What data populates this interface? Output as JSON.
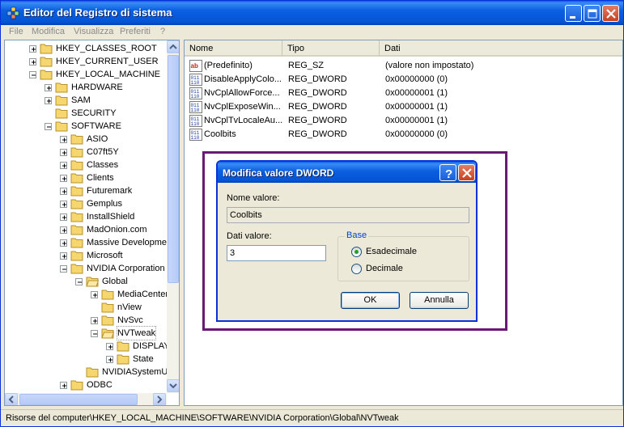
{
  "window": {
    "title": "Editor del Registro di sistema",
    "app_icon": "regedit-icon",
    "controls": [
      "minimize-icon",
      "maximize-icon",
      "close-icon"
    ]
  },
  "menu": [
    "File",
    "Modifica",
    "Visualizza",
    "Preferiti",
    "?"
  ],
  "tree": [
    {
      "label": "HKEY_CLASSES_ROOT",
      "level": 0,
      "state": "collapsed"
    },
    {
      "label": "HKEY_CURRENT_USER",
      "level": 0,
      "state": "collapsed"
    },
    {
      "label": "HKEY_LOCAL_MACHINE",
      "level": 0,
      "state": "expanded"
    },
    {
      "label": "HARDWARE",
      "level": 1,
      "state": "collapsed"
    },
    {
      "label": "SAM",
      "level": 1,
      "state": "collapsed"
    },
    {
      "label": "SECURITY",
      "level": 1,
      "state": "none"
    },
    {
      "label": "SOFTWARE",
      "level": 1,
      "state": "expanded"
    },
    {
      "label": "ASIO",
      "level": 2,
      "state": "collapsed"
    },
    {
      "label": "C07ft5Y",
      "level": 2,
      "state": "collapsed"
    },
    {
      "label": "Classes",
      "level": 2,
      "state": "collapsed"
    },
    {
      "label": "Clients",
      "level": 2,
      "state": "collapsed"
    },
    {
      "label": "Futuremark",
      "level": 2,
      "state": "collapsed"
    },
    {
      "label": "Gemplus",
      "level": 2,
      "state": "collapsed"
    },
    {
      "label": "InstallShield",
      "level": 2,
      "state": "collapsed"
    },
    {
      "label": "MadOnion.com",
      "level": 2,
      "state": "collapsed"
    },
    {
      "label": "Massive Development",
      "level": 2,
      "state": "collapsed"
    },
    {
      "label": "Microsoft",
      "level": 2,
      "state": "collapsed"
    },
    {
      "label": "NVIDIA Corporation",
      "level": 2,
      "state": "expanded"
    },
    {
      "label": "Global",
      "level": 3,
      "state": "expanded"
    },
    {
      "label": "MediaCenter",
      "level": 4,
      "state": "collapsed"
    },
    {
      "label": "nView",
      "level": 4,
      "state": "none"
    },
    {
      "label": "NvSvc",
      "level": 4,
      "state": "collapsed"
    },
    {
      "label": "NVTweak",
      "level": 4,
      "state": "expanded",
      "selected": true
    },
    {
      "label": "DISPLAY",
      "level": 5,
      "state": "collapsed"
    },
    {
      "label": "State",
      "level": 5,
      "state": "collapsed"
    },
    {
      "label": "NVIDIASystemUpdate",
      "level": 3,
      "state": "none"
    },
    {
      "label": "ODBC",
      "level": 2,
      "state": "collapsed"
    }
  ],
  "list": {
    "columns": [
      "Nome",
      "Tipo",
      "Dati"
    ],
    "rows": [
      {
        "name": "(Predefinito)",
        "type": "REG_SZ",
        "data": "(valore non impostato)",
        "icon": "string-value-icon"
      },
      {
        "name": "DisableApplyColo...",
        "type": "REG_DWORD",
        "data": "0x00000000 (0)",
        "icon": "binary-value-icon"
      },
      {
        "name": "NvCplAllowForce...",
        "type": "REG_DWORD",
        "data": "0x00000001 (1)",
        "icon": "binary-value-icon"
      },
      {
        "name": "NvCplExposeWin...",
        "type": "REG_DWORD",
        "data": "0x00000001 (1)",
        "icon": "binary-value-icon"
      },
      {
        "name": "NvCplTvLocaleAu...",
        "type": "REG_DWORD",
        "data": "0x00000001 (1)",
        "icon": "binary-value-icon"
      },
      {
        "name": "Coolbits",
        "type": "REG_DWORD",
        "data": "0x00000000 (0)",
        "icon": "binary-value-icon"
      }
    ]
  },
  "dialog": {
    "title": "Modifica valore DWORD",
    "name_label": "Nome valore:",
    "name_value": "Coolbits",
    "data_label": "Dati valore:",
    "data_value": "3",
    "base_label": "Base",
    "radio_hex": "Esadecimale",
    "radio_dec": "Decimale",
    "selected_base": "hex",
    "ok": "OK",
    "cancel": "Annulla"
  },
  "status": "Risorse del computer\\HKEY_LOCAL_MACHINE\\SOFTWARE\\NVIDIA Corporation\\Global\\NVTweak",
  "colors": {
    "titlebar": "#0a5fe0",
    "highlight_frame": "#6a1a75",
    "folder": "#f5d66f",
    "radio_dot": "#21a121"
  }
}
